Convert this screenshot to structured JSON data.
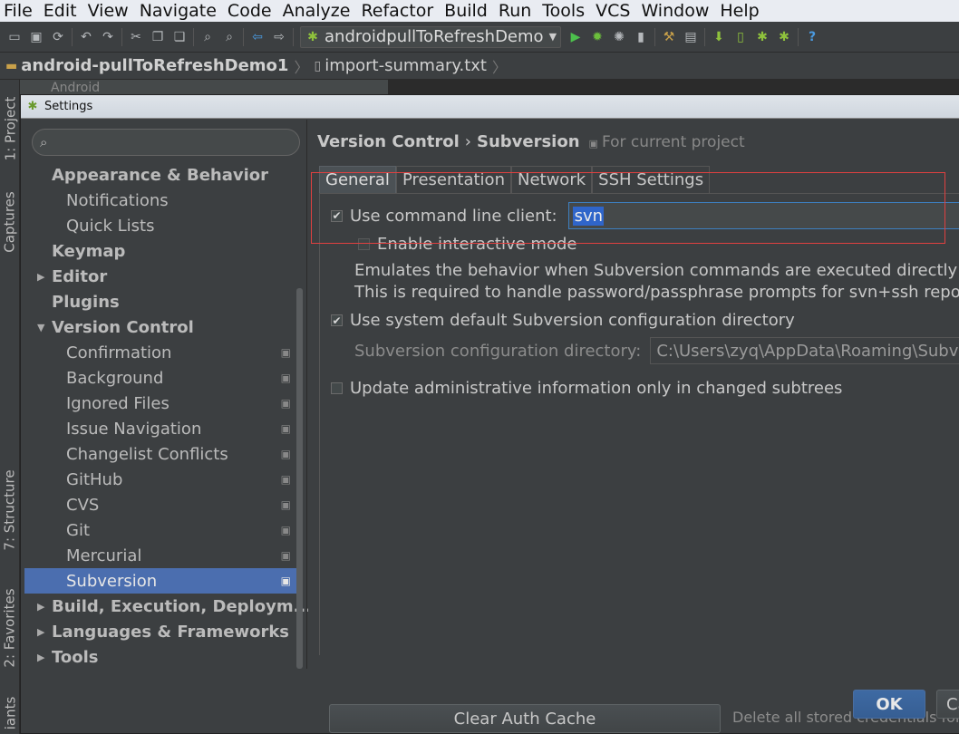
{
  "menubar": {
    "items": [
      "File",
      "Edit",
      "View",
      "Navigate",
      "Code",
      "Analyze",
      "Refactor",
      "Build",
      "Run",
      "Tools",
      "VCS",
      "Window",
      "Help"
    ]
  },
  "toolbar": {
    "run_config": "androidpullToRefreshDemo",
    "help_glyph": "?"
  },
  "navbar": {
    "project": "android-pullToRefreshDemo1",
    "file": "import-summary.txt"
  },
  "left_stripe": {
    "project": "1: Project",
    "captures": "Captures",
    "structure": "7: Structure",
    "favorites": "2: Favorites",
    "variants": "iants"
  },
  "background": {
    "project_header": "Android"
  },
  "dialog": {
    "title": "Settings",
    "search_placeholder": "",
    "tree": [
      {
        "label": "Appearance & Behavior",
        "level": 0,
        "arrow": ""
      },
      {
        "label": "Notifications",
        "level": 1
      },
      {
        "label": "Quick Lists",
        "level": 1
      },
      {
        "label": "Keymap",
        "level": 0,
        "arrow": ""
      },
      {
        "label": "Editor",
        "level": 0,
        "arrow": "▶"
      },
      {
        "label": "Plugins",
        "level": 0,
        "arrow": ""
      },
      {
        "label": "Version Control",
        "level": 0,
        "arrow": "▼"
      },
      {
        "label": "Confirmation",
        "level": 1,
        "project": true
      },
      {
        "label": "Background",
        "level": 1,
        "project": true
      },
      {
        "label": "Ignored Files",
        "level": 1,
        "project": true
      },
      {
        "label": "Issue Navigation",
        "level": 1,
        "project": true
      },
      {
        "label": "Changelist Conflicts",
        "level": 1,
        "project": true
      },
      {
        "label": "GitHub",
        "level": 1,
        "project": true
      },
      {
        "label": "CVS",
        "level": 1,
        "project": true
      },
      {
        "label": "Git",
        "level": 1,
        "project": true
      },
      {
        "label": "Mercurial",
        "level": 1,
        "project": true
      },
      {
        "label": "Subversion",
        "level": 1,
        "project": true,
        "selected": true
      },
      {
        "label": "Build, Execution, Deploym...",
        "level": 0,
        "arrow": "▶"
      },
      {
        "label": "Languages & Frameworks",
        "level": 0,
        "arrow": "▶"
      },
      {
        "label": "Tools",
        "level": 0,
        "arrow": "▶"
      }
    ],
    "header": {
      "section": "Version Control",
      "separator": "›",
      "page": "Subversion",
      "scope": "For current project"
    },
    "tabs": [
      "General",
      "Presentation",
      "Network",
      "SSH Settings"
    ],
    "general": {
      "use_cmd_client_label": "Use command line client:",
      "cmd_client_value": "svn",
      "interactive_mode_label": "Enable interactive mode",
      "desc_line1": "Emulates the behavior when Subversion commands are executed directly from",
      "desc_line2": "This is required to handle password/passphrase prompts for svn+ssh repositor",
      "use_default_dir_label": "Use system default Subversion configuration directory",
      "config_dir_label": "Subversion configuration directory:",
      "config_dir_value": "C:\\Users\\zyq\\AppData\\Roaming\\Subvers",
      "update_admin_label": "Update administrative information only in changed subtrees"
    },
    "clear_cache_label": "Clear Auth Cache",
    "clear_cache_desc": "Delete all stored credentials for 'h",
    "ok_label": "OK",
    "cancel_label": "Ca"
  }
}
